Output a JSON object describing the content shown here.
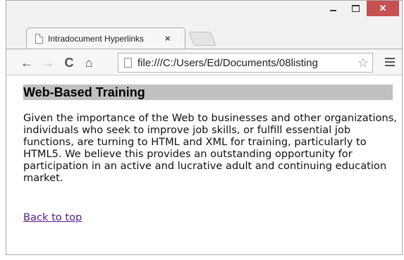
{
  "browser": {
    "tab": {
      "title": "Intradocument Hyperlinks",
      "close_glyph": "×"
    },
    "address_bar": {
      "url": "file:///C:/Users/Ed/Documents/08listing"
    },
    "icons": {
      "back": "←",
      "forward": "→",
      "reload": "C",
      "home": "⌂",
      "star": "☆",
      "minimize": "minimize-icon",
      "maximize": "maximize-icon",
      "close": "✕"
    }
  },
  "page": {
    "heading": "Web-Based Training",
    "paragraph": "Given the importance of the Web to businesses and other organizations, individuals who seek to improve job skills, or fulfill essential job functions, are turning to HTML and XML for training, particularly to HTML5. We believe this provides an outstanding opportunity for participation in an active and lucrative adult and continuing education market.",
    "link": "Back to top"
  },
  "colors": {
    "heading_background": "#c0c0c0",
    "visited_link": "#551a8b",
    "close_button": "#c75050"
  }
}
